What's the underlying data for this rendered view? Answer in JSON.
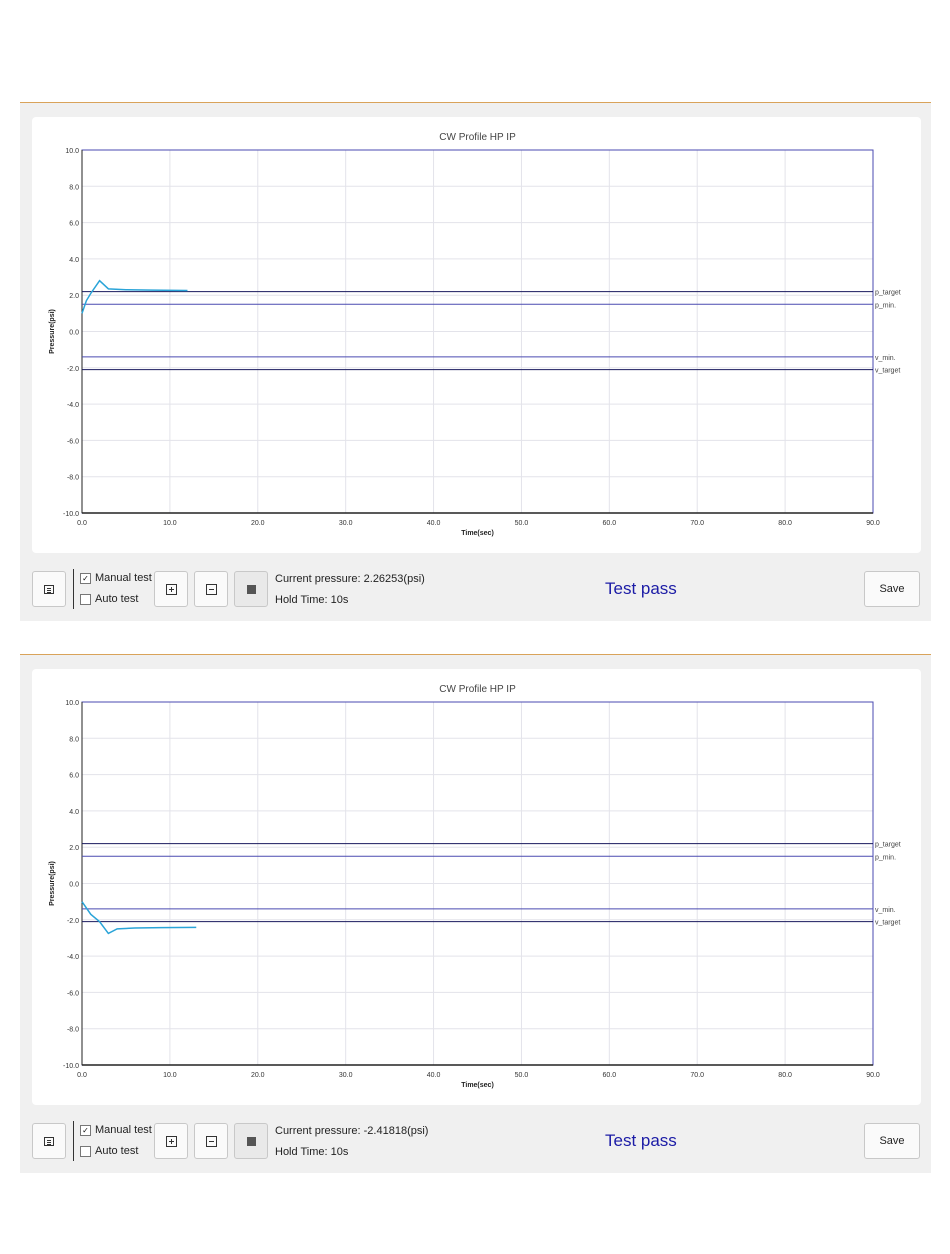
{
  "colors": {
    "accent_line": "#d9a35a",
    "curve": "#2aa4d8",
    "frame": "#1c1ca6",
    "status": "#1c1ca6"
  },
  "chart_data": [
    {
      "type": "line",
      "title": "CW Profile HP IP",
      "xlabel": "Time(sec)",
      "ylabel": "Pressure(psi)",
      "xlim": [
        0,
        90
      ],
      "ylim": [
        -10,
        10
      ],
      "xticks": [
        "0.0",
        "10.0",
        "20.0",
        "30.0",
        "40.0",
        "50.0",
        "60.0",
        "70.0",
        "80.0",
        "90.0"
      ],
      "yticks": [
        "10.0",
        "8.0",
        "6.0",
        "4.0",
        "2.0",
        "0.0",
        "-2.0",
        "-4.0",
        "-6.0",
        "-8.0",
        "-10.0"
      ],
      "grid": true,
      "reference_lines": [
        {
          "label": "p_target",
          "y": 2.2
        },
        {
          "label": "p_min.",
          "y": 1.5
        },
        {
          "label": "v_min.",
          "y": -1.4
        },
        {
          "label": "v_target",
          "y": -2.1
        }
      ],
      "series": [
        {
          "x": [
            0,
            0.5,
            1,
            2,
            3,
            5,
            8,
            12
          ],
          "y": [
            1.0,
            1.7,
            2.1,
            2.8,
            2.35,
            2.3,
            2.28,
            2.26
          ]
        }
      ]
    },
    {
      "type": "line",
      "title": "CW Profile HP IP",
      "xlabel": "Time(sec)",
      "ylabel": "Pressure(psi)",
      "xlim": [
        0,
        90
      ],
      "ylim": [
        -10,
        10
      ],
      "xticks": [
        "0.0",
        "10.0",
        "20.0",
        "30.0",
        "40.0",
        "50.0",
        "60.0",
        "70.0",
        "80.0",
        "90.0"
      ],
      "yticks": [
        "10.0",
        "8.0",
        "6.0",
        "4.0",
        "2.0",
        "0.0",
        "-2.0",
        "-4.0",
        "-6.0",
        "-8.0",
        "-10.0"
      ],
      "grid": true,
      "reference_lines": [
        {
          "label": "p_target",
          "y": 2.2
        },
        {
          "label": "p_min.",
          "y": 1.5
        },
        {
          "label": "v_min.",
          "y": -1.4
        },
        {
          "label": "v_target",
          "y": -2.1
        }
      ],
      "series": [
        {
          "x": [
            0,
            1,
            2,
            3,
            4,
            6,
            9,
            13
          ],
          "y": [
            -1.0,
            -1.7,
            -2.1,
            -2.75,
            -2.5,
            -2.45,
            -2.43,
            -2.42
          ]
        }
      ]
    }
  ],
  "panels": [
    {
      "manual_label": "Manual test",
      "auto_label": "Auto test",
      "manual_checked": true,
      "auto_checked": false,
      "pressure_text": "Current pressure: 2.26253(psi)",
      "hold_text": "Hold Time: 10s",
      "status_text": "Test pass",
      "save_label": "Save",
      "check_mark": "✓"
    },
    {
      "manual_label": "Manual test",
      "auto_label": "Auto test",
      "manual_checked": true,
      "auto_checked": false,
      "pressure_text": "Current pressure: -2.41818(psi)",
      "hold_text": "Hold Time: 10s",
      "status_text": "Test pass",
      "save_label": "Save",
      "check_mark": "✓"
    }
  ]
}
